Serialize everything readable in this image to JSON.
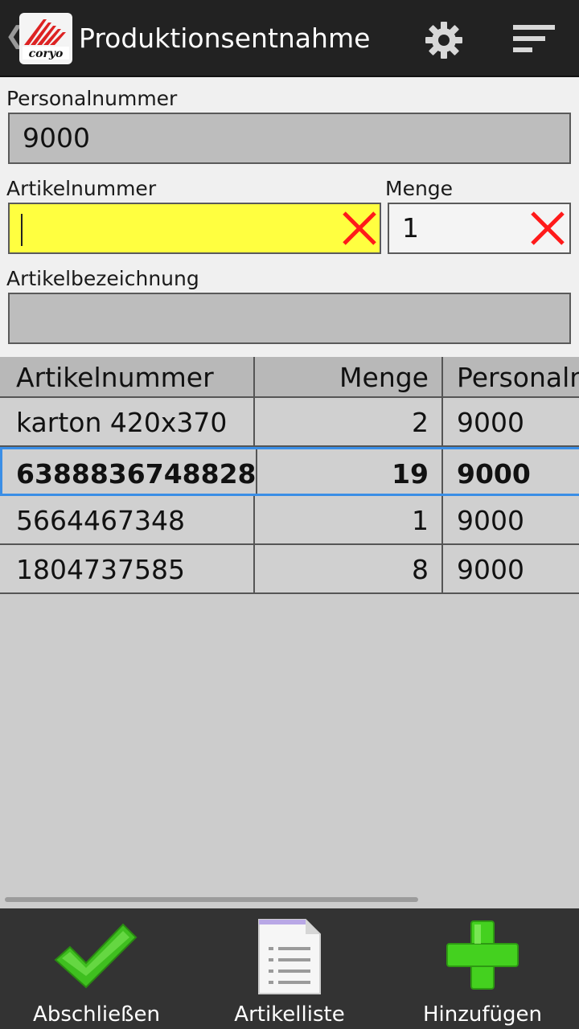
{
  "header": {
    "title": "Produktionsentnahme",
    "up_caret": "❮"
  },
  "form": {
    "personalnummer_label": "Personalnummer",
    "personalnummer_value": "9000",
    "artikelnummer_label": "Artikelnummer",
    "artikelnummer_value": "",
    "menge_label": "Menge",
    "menge_value": "1",
    "artikelbezeichnung_label": "Artikelbezeichnung",
    "artikelbezeichnung_value": ""
  },
  "table": {
    "columns": [
      "Artikelnummer",
      "Menge",
      "Personalnummer"
    ],
    "rows": [
      {
        "artikelnummer": "karton 420x370",
        "menge": "2",
        "personalnummer": "9000"
      },
      {
        "artikelnummer": "6388836748828",
        "menge": "19",
        "personalnummer": "9000"
      },
      {
        "artikelnummer": "5664467348",
        "menge": "1",
        "personalnummer": "9000"
      },
      {
        "artikelnummer": "1804737585",
        "menge": "8",
        "personalnummer": "9000"
      }
    ]
  },
  "bottombar": {
    "finish_label": "Abschließen",
    "list_label": "Artikelliste",
    "add_label": "Hinzufügen"
  },
  "colors": {
    "actionbar": "#222222",
    "highlight_field": "#ffff40",
    "selection": "#3a8ee6",
    "clear_x": "#ff1a1a",
    "check_green": "#3fbf1f",
    "add_green": "#44d11f"
  }
}
